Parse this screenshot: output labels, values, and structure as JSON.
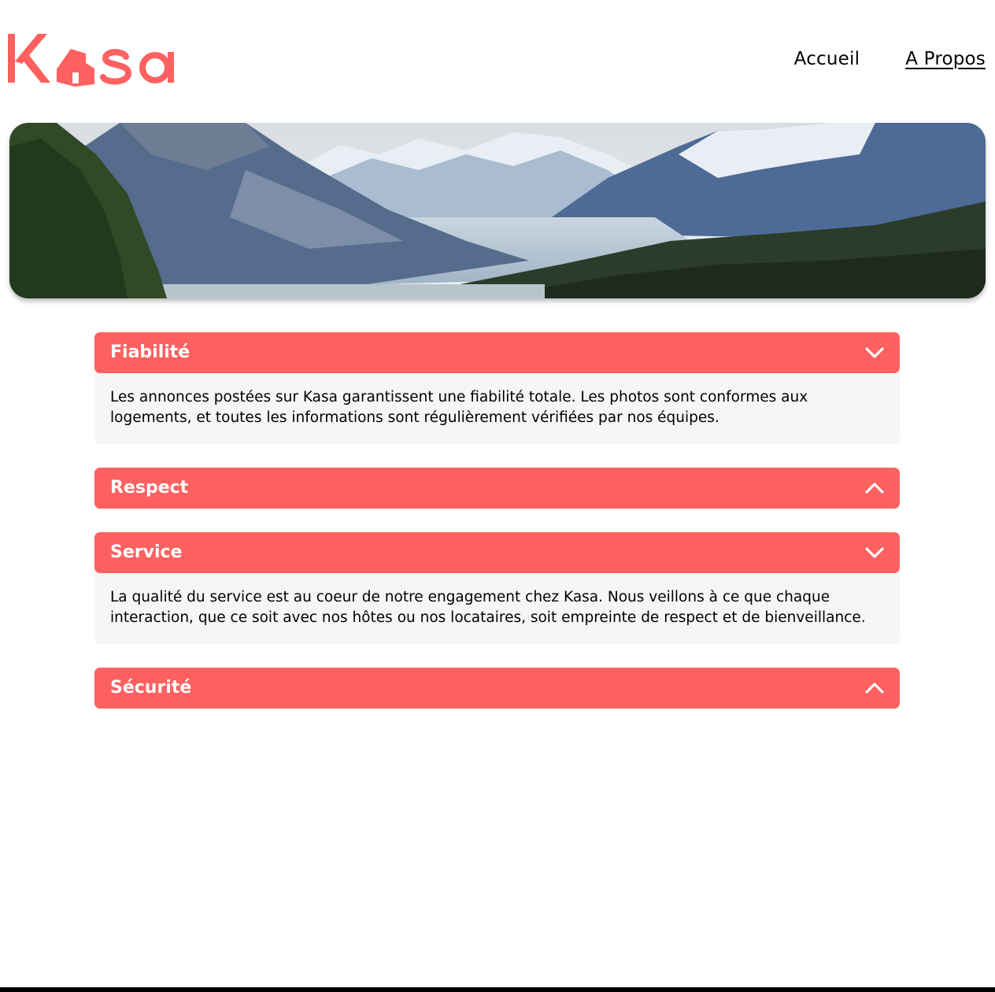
{
  "brand": {
    "name": "Kasa",
    "color": "#FF6060"
  },
  "nav": {
    "home": "Accueil",
    "about": "A Propos",
    "active": "about"
  },
  "banner": {
    "alt": "mountain-landscape"
  },
  "colors": {
    "accent": "#FF6060",
    "body_bg": "#F6F6F6",
    "text": "#000000"
  },
  "sections": [
    {
      "title": "Fiabilité",
      "open": true,
      "icon": "chevron-down-icon",
      "content": "Les annonces postées sur Kasa garantissent une fiabilité totale. Les photos sont conformes aux logements, et toutes les informations sont régulièrement vérifiées par nos équipes."
    },
    {
      "title": "Respect",
      "open": false,
      "icon": "chevron-up-icon",
      "content": ""
    },
    {
      "title": "Service",
      "open": true,
      "icon": "chevron-down-icon",
      "content": "La qualité du service est au coeur de notre engagement chez Kasa. Nous veillons à ce que chaque interaction, que ce soit avec nos hôtes ou nos locataires, soit empreinte de respect et de bienveillance."
    },
    {
      "title": "Sécurité",
      "open": false,
      "icon": "chevron-up-icon",
      "content": ""
    }
  ]
}
